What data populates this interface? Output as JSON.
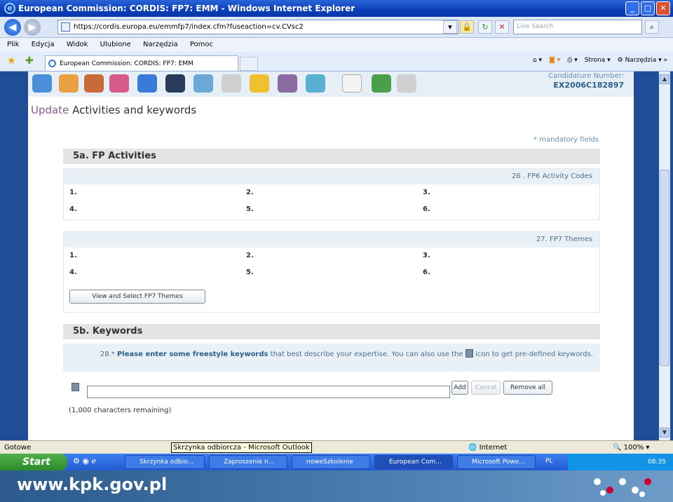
{
  "window": {
    "title": "European Commission: CORDIS: FP7: EMM - Windows Internet Explorer"
  },
  "address": {
    "url": "https://cordis.europa.eu/emmfp7/index.cfm?fuseaction=cv.CVsc2",
    "search_placeholder": "Live Search"
  },
  "menu": [
    "Plik",
    "Edycja",
    "Widok",
    "Ulubione",
    "Narzędzia",
    "Pomoc"
  ],
  "tab": {
    "label": "European Commission: CORDIS: FP7: EMM"
  },
  "toolbar": {
    "page": "Strona",
    "tools": "Narzędzia"
  },
  "page": {
    "candidature_label": "Candidature Number:",
    "candidature_number": "EX2006C182897",
    "title_update": "Update",
    "title_rest": "Activities and keywords",
    "mandatory": "* mandatory fields",
    "section_a": "5a. FP Activities",
    "fp6_header": "26 . FP6 Activity Codes",
    "fp7_header": "27. FP7 Themes",
    "numbers": [
      "1.",
      "2.",
      "3.",
      "4.",
      "5.",
      "6."
    ],
    "view_button": "View and Select FP7 Themes",
    "section_b": "5b. Keywords",
    "kw_prefix": "28.*",
    "kw_bold": "Please enter some freestyle keywords",
    "kw_rest": "that best describe your expertise. You can also use the",
    "kw_end": "icon to get pre-defined keywords.",
    "add": "Add",
    "cancel": "Cancel",
    "remove_all": "Remove all",
    "remaining": "(1,000 characters remaining)"
  },
  "status": {
    "left": "Gotowe",
    "tooltip": "Skrzynka odbiorcza - Microsoft Outlook",
    "zone": "Internet",
    "zoom": "100%"
  },
  "taskbar": {
    "start": "Start",
    "tasks": [
      "Skrzynka odbio...",
      "Zaproszenie n...",
      "noweSzkolenie",
      "European Com...",
      "Microsoft Powe..."
    ],
    "lang": "PL",
    "time": "08:35"
  },
  "footer": {
    "url": "www.kpk.gov.pl"
  }
}
